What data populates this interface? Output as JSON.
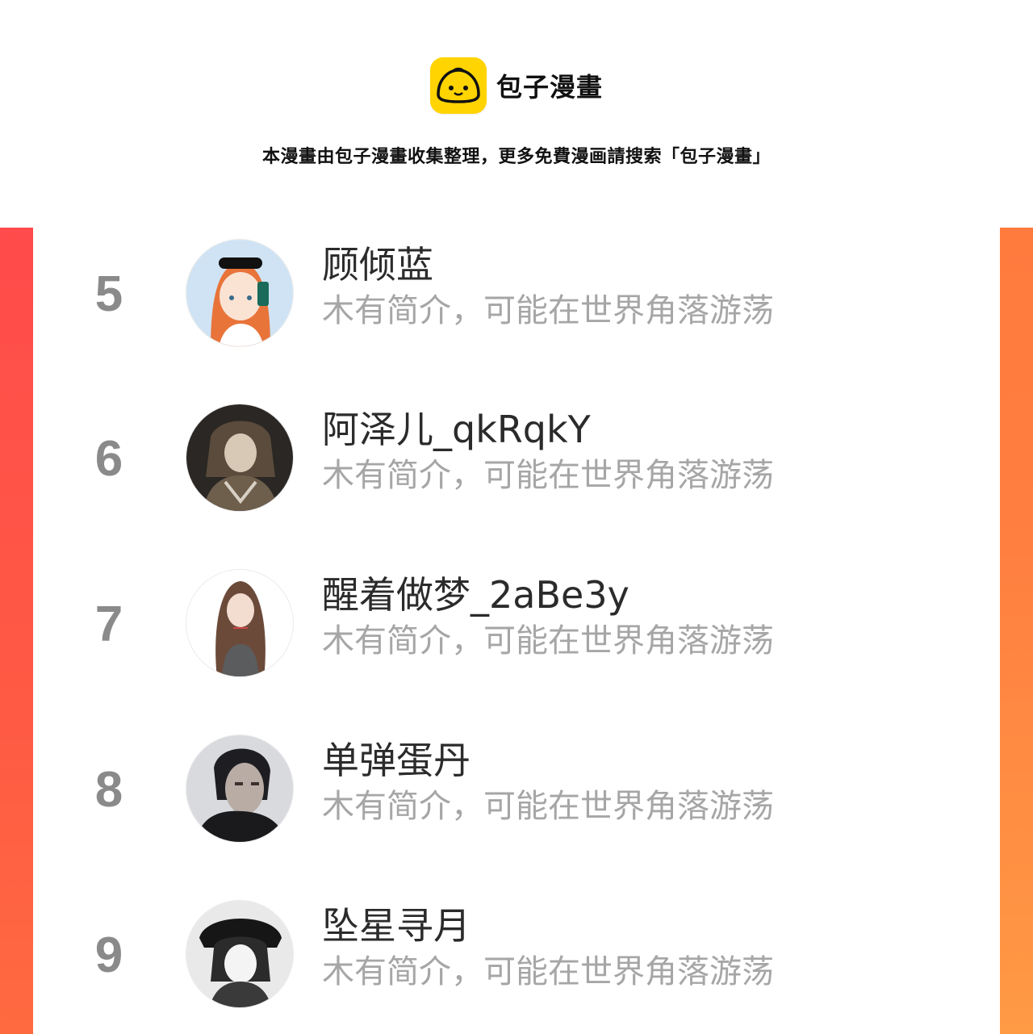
{
  "header": {
    "logo_icon": "bun-mascot-icon",
    "logo_color": "#ffd400",
    "brand_name": "包子漫畫",
    "notice": "本漫畫由包子漫畫收集整理，更多免費漫画請搜索「包子漫畫」"
  },
  "colors": {
    "accent_left": "#ff4b4b",
    "accent_right": "#ff8a40",
    "rank_number": "#8a8a8a",
    "username": "#2b2b2b",
    "bio": "#a6a6a6"
  },
  "ranking": [
    {
      "rank": "5",
      "name": "顾倾蓝",
      "bio": "木有简介，可能在世界角落游荡",
      "avatar_icon": "girl-sunglasses-selfie-avatar"
    },
    {
      "rank": "6",
      "name": "阿泽儿_qkRqkY",
      "bio": "木有简介，可能在世界角落游荡",
      "avatar_icon": "dark-anime-character-avatar"
    },
    {
      "rank": "7",
      "name": "醒着做梦_2aBe3y",
      "bio": "木有简介，可能在世界角落游荡",
      "avatar_icon": "long-hair-girl-avatar"
    },
    {
      "rank": "8",
      "name": "单弹蛋丹",
      "bio": "木有简介，可能在世界角落游荡",
      "avatar_icon": "man-portrait-avatar"
    },
    {
      "rank": "9",
      "name": "坠星寻月",
      "bio": "木有简介，可能在世界角落游荡",
      "avatar_icon": "monochrome-anime-boy-avatar"
    }
  ]
}
